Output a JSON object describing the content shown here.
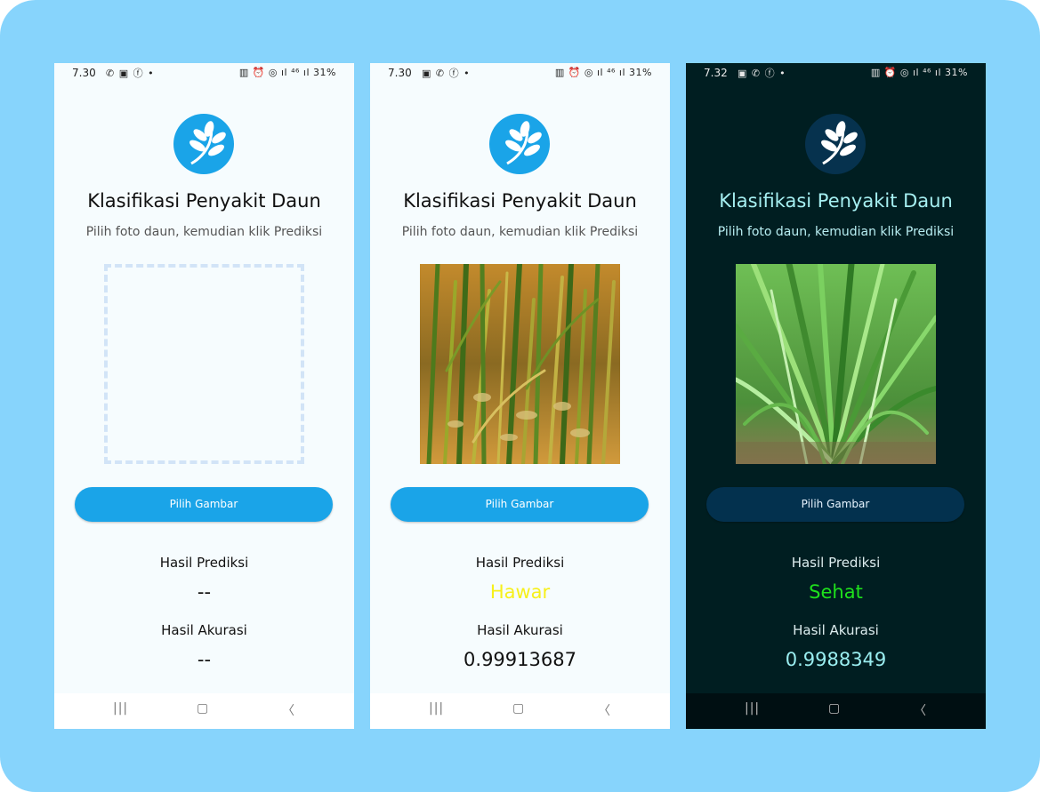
{
  "colors": {
    "background": "#87d4fc",
    "accent": "#1aa4e8",
    "dark_button": "#03314e",
    "hawar_color": "#f7f01a",
    "sehat_color": "#1ee11c",
    "dark_accuracy_color": "#9aeef0"
  },
  "screens": [
    {
      "theme": "light",
      "status": {
        "time": "7.30",
        "icons": "whatsapp-icon image-icon facebook-icon dot",
        "right": "31%"
      },
      "title": "Klasifikasi Penyakit Daun",
      "subtitle": "Pilih foto daun, kemudian klik Prediksi",
      "image": "empty-placeholder",
      "button_label": "Pilih Gambar",
      "prediction_label": "Hasil Prediksi",
      "prediction_value": "--",
      "accuracy_label": "Hasil Akurasi",
      "accuracy_value": "--"
    },
    {
      "theme": "light",
      "status": {
        "time": "7.30",
        "icons": "image-icon whatsapp-icon facebook-icon dot",
        "right": "31%"
      },
      "title": "Klasifikasi Penyakit Daun",
      "subtitle": "Pilih foto daun, kemudian klik Prediksi",
      "image": "rice-plant-photo-yellow",
      "button_label": "Pilih Gambar",
      "prediction_label": "Hasil Prediksi",
      "prediction_value": "Hawar",
      "accuracy_label": "Hasil Akurasi",
      "accuracy_value": "0.99913687"
    },
    {
      "theme": "dark",
      "status": {
        "time": "7.32",
        "icons": "image-icon whatsapp-icon facebook-icon dot",
        "right": "31%"
      },
      "title": "Klasifikasi Penyakit Daun",
      "subtitle": "Pilih foto daun, kemudian klik Prediksi",
      "image": "rice-plant-photo-green",
      "button_label": "Pilih Gambar",
      "prediction_label": "Hasil Prediksi",
      "prediction_value": "Sehat",
      "accuracy_label": "Hasil Akurasi",
      "accuracy_value": "0.9988349"
    }
  ]
}
